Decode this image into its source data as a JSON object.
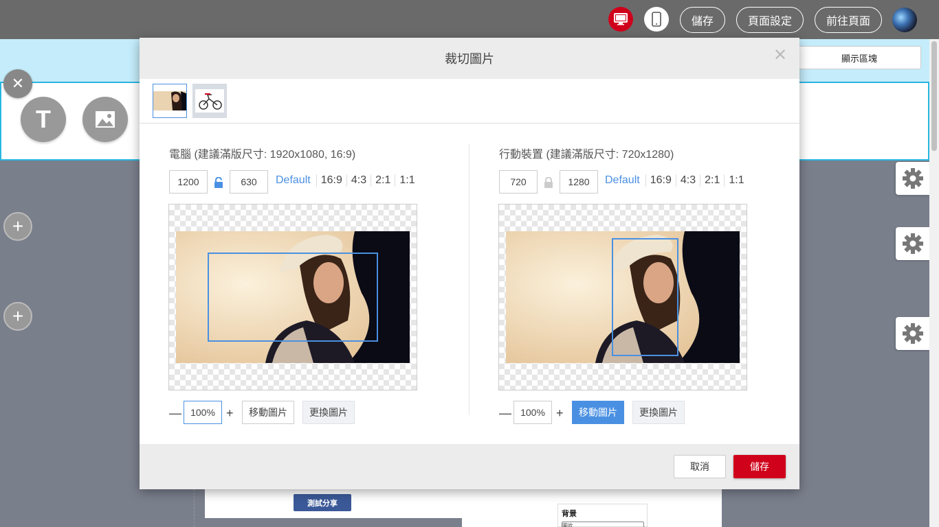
{
  "topbar": {
    "desktop_icon": "desktop-icon",
    "mobile_icon": "mobile-icon",
    "save_label": "儲存",
    "page_settings_label": "頁面設定",
    "go_to_page_label": "前往頁面"
  },
  "background": {
    "show_block_label": "顯示區塊",
    "share_button_label": "測試分享",
    "bg_panel_label": "背景",
    "bg_panel_select": "圖片"
  },
  "modal": {
    "title": "裁切圖片",
    "desktop": {
      "title": "電腦 (建議滿版尺寸: 1920x1080, 16:9)",
      "width": "1200",
      "height": "630",
      "ratios": [
        "Default",
        "16:9",
        "4:3",
        "2:1",
        "1:1"
      ],
      "zoom": "100%",
      "move_label": "移動圖片",
      "replace_label": "更換圖片"
    },
    "mobile": {
      "title": "行動裝置 (建議滿版尺寸: 720x1280)",
      "width": "720",
      "height": "1280",
      "ratios": [
        "Default",
        "16:9",
        "4:3",
        "2:1",
        "1:1"
      ],
      "zoom": "100%",
      "move_label": "移動圖片",
      "replace_label": "更換圖片"
    },
    "cancel_label": "取消",
    "save_label": "儲存"
  },
  "colors": {
    "accent": "#4a90e2",
    "brand_red": "#d0021b"
  }
}
